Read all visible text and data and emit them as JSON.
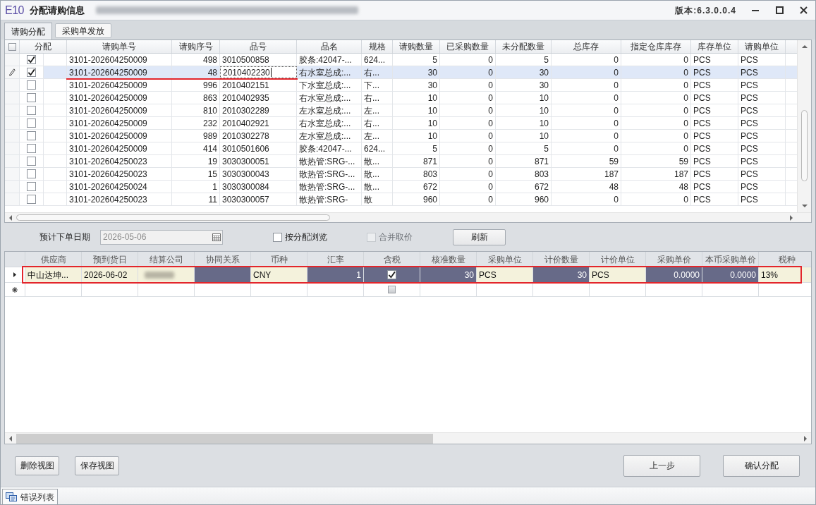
{
  "window": {
    "logo": "E10",
    "title": "分配请购信息",
    "version": "版本:6.3.0.0.4"
  },
  "tabs": [
    {
      "label": "请购分配",
      "selected": true
    },
    {
      "label": "采购单发放",
      "selected": false
    }
  ],
  "request_grid": {
    "select_all": {
      "checked": false
    },
    "allocate_column": "分配",
    "columns": [
      "请购单号",
      "请购序号",
      "品号",
      "品名",
      "规格",
      "请购数量",
      "已采购数量",
      "未分配数量",
      "总库存",
      "指定仓库库存",
      "库存单位",
      "请购单位"
    ],
    "rows": [
      {
        "allocated": true,
        "selected": false,
        "editing": false,
        "annotated": false,
        "cells": [
          "3101-202604250009",
          "498",
          "3010500858",
          "胶条:42047-...",
          "624...",
          "5",
          "0",
          "5",
          "0",
          "0",
          "PCS",
          "PCS"
        ]
      },
      {
        "allocated": true,
        "selected": true,
        "editing": true,
        "annotated": true,
        "cells": [
          "3101-202604250009",
          "48",
          "2010402230",
          "右水室总成:...",
          "右...",
          "30",
          "0",
          "30",
          "0",
          "0",
          "PCS",
          "PCS"
        ]
      },
      {
        "allocated": false,
        "selected": false,
        "editing": false,
        "annotated": false,
        "cells": [
          "3101-202604250009",
          "996",
          "2010402151",
          "下水室总成:...",
          "下...",
          "30",
          "0",
          "30",
          "0",
          "0",
          "PCS",
          "PCS"
        ]
      },
      {
        "allocated": false,
        "selected": false,
        "editing": false,
        "annotated": false,
        "cells": [
          "3101-202604250009",
          "863",
          "2010402935",
          "右水室总成:...",
          "右...",
          "10",
          "0",
          "10",
          "0",
          "0",
          "PCS",
          "PCS"
        ]
      },
      {
        "allocated": false,
        "selected": false,
        "editing": false,
        "annotated": false,
        "cells": [
          "3101-202604250009",
          "810",
          "2010302289",
          "左水室总成:...",
          "左...",
          "10",
          "0",
          "10",
          "0",
          "0",
          "PCS",
          "PCS"
        ]
      },
      {
        "allocated": false,
        "selected": false,
        "editing": false,
        "annotated": false,
        "cells": [
          "3101-202604250009",
          "232",
          "2010402921",
          "右水室总成:...",
          "右...",
          "10",
          "0",
          "10",
          "0",
          "0",
          "PCS",
          "PCS"
        ]
      },
      {
        "allocated": false,
        "selected": false,
        "editing": false,
        "annotated": false,
        "cells": [
          "3101-202604250009",
          "989",
          "2010302278",
          "左水室总成:...",
          "左...",
          "10",
          "0",
          "10",
          "0",
          "0",
          "PCS",
          "PCS"
        ]
      },
      {
        "allocated": false,
        "selected": false,
        "editing": false,
        "annotated": false,
        "cells": [
          "3101-202604250009",
          "414",
          "3010501606",
          "胶条:42047-...",
          "624...",
          "5",
          "0",
          "5",
          "0",
          "0",
          "PCS",
          "PCS"
        ]
      },
      {
        "allocated": false,
        "selected": false,
        "editing": false,
        "annotated": false,
        "cells": [
          "3101-202604250023",
          "19",
          "3030300051",
          "散热管:SRG-...",
          "散...",
          "871",
          "0",
          "871",
          "59",
          "59",
          "PCS",
          "PCS"
        ]
      },
      {
        "allocated": false,
        "selected": false,
        "editing": false,
        "annotated": false,
        "cells": [
          "3101-202604250023",
          "15",
          "3030300043",
          "散热管:SRG-...",
          "散...",
          "803",
          "0",
          "803",
          "187",
          "187",
          "PCS",
          "PCS"
        ]
      },
      {
        "allocated": false,
        "selected": false,
        "editing": false,
        "annotated": false,
        "cells": [
          "3101-202604250024",
          "1",
          "3030300084",
          "散热管:SRG-...",
          "散...",
          "672",
          "0",
          "672",
          "48",
          "48",
          "PCS",
          "PCS"
        ]
      },
      {
        "allocated": false,
        "selected": false,
        "editing": false,
        "annotated": false,
        "cells": [
          "3101-202604250023",
          "11",
          "3030300057",
          "散热管:SRG-",
          "散",
          "960",
          "0",
          "960",
          "0",
          "0",
          "PCS",
          "PCS"
        ]
      }
    ]
  },
  "filters": {
    "order_date": {
      "label": "预计下单日期",
      "value": "2026-05-06",
      "disabled": true
    },
    "browse_by_allocation": {
      "label": "按分配浏览",
      "checked": false,
      "disabled": false
    },
    "merge_price": {
      "label": "合并取价",
      "checked": false,
      "disabled": true
    },
    "refresh_button": "刷新"
  },
  "order_grid": {
    "columns": [
      "供应商",
      "预到货日",
      "结算公司",
      "协同关系",
      "币种",
      "汇率",
      "含税",
      "核准数量",
      "采购单位",
      "计价数量",
      "计价单位",
      "采购单价",
      "本币采购单价",
      "税种"
    ],
    "rows": [
      {
        "current": true,
        "annotated": true,
        "cells": [
          {
            "kind": "text",
            "text": "中山达坤...",
            "locked": false
          },
          {
            "kind": "text",
            "text": "2026-06-02",
            "locked": false
          },
          {
            "kind": "redacted",
            "locked": false
          },
          {
            "kind": "empty",
            "locked": true
          },
          {
            "kind": "text",
            "text": "CNY",
            "locked": false
          },
          {
            "kind": "text",
            "text": "1",
            "locked": true
          },
          {
            "kind": "checkbox",
            "checked": true,
            "locked": true
          },
          {
            "kind": "text",
            "text": "30",
            "locked": true
          },
          {
            "kind": "text",
            "text": "PCS",
            "locked": false
          },
          {
            "kind": "text",
            "text": "30",
            "locked": true
          },
          {
            "kind": "text",
            "text": "PCS",
            "locked": false
          },
          {
            "kind": "text",
            "text": "0.0000",
            "locked": true
          },
          {
            "kind": "text",
            "text": "0.0000",
            "locked": true
          },
          {
            "kind": "text",
            "text": "13%",
            "locked": false
          }
        ]
      }
    ],
    "new_row": {
      "tax_checkbox": {
        "checked": false,
        "disabled": true
      }
    }
  },
  "footer": {
    "left_buttons": [
      "删除视图",
      "保存视图"
    ],
    "right_buttons": [
      "上一步",
      "确认分配"
    ]
  },
  "status_bar": {
    "tabs": [
      {
        "label": "错误列表"
      }
    ]
  }
}
